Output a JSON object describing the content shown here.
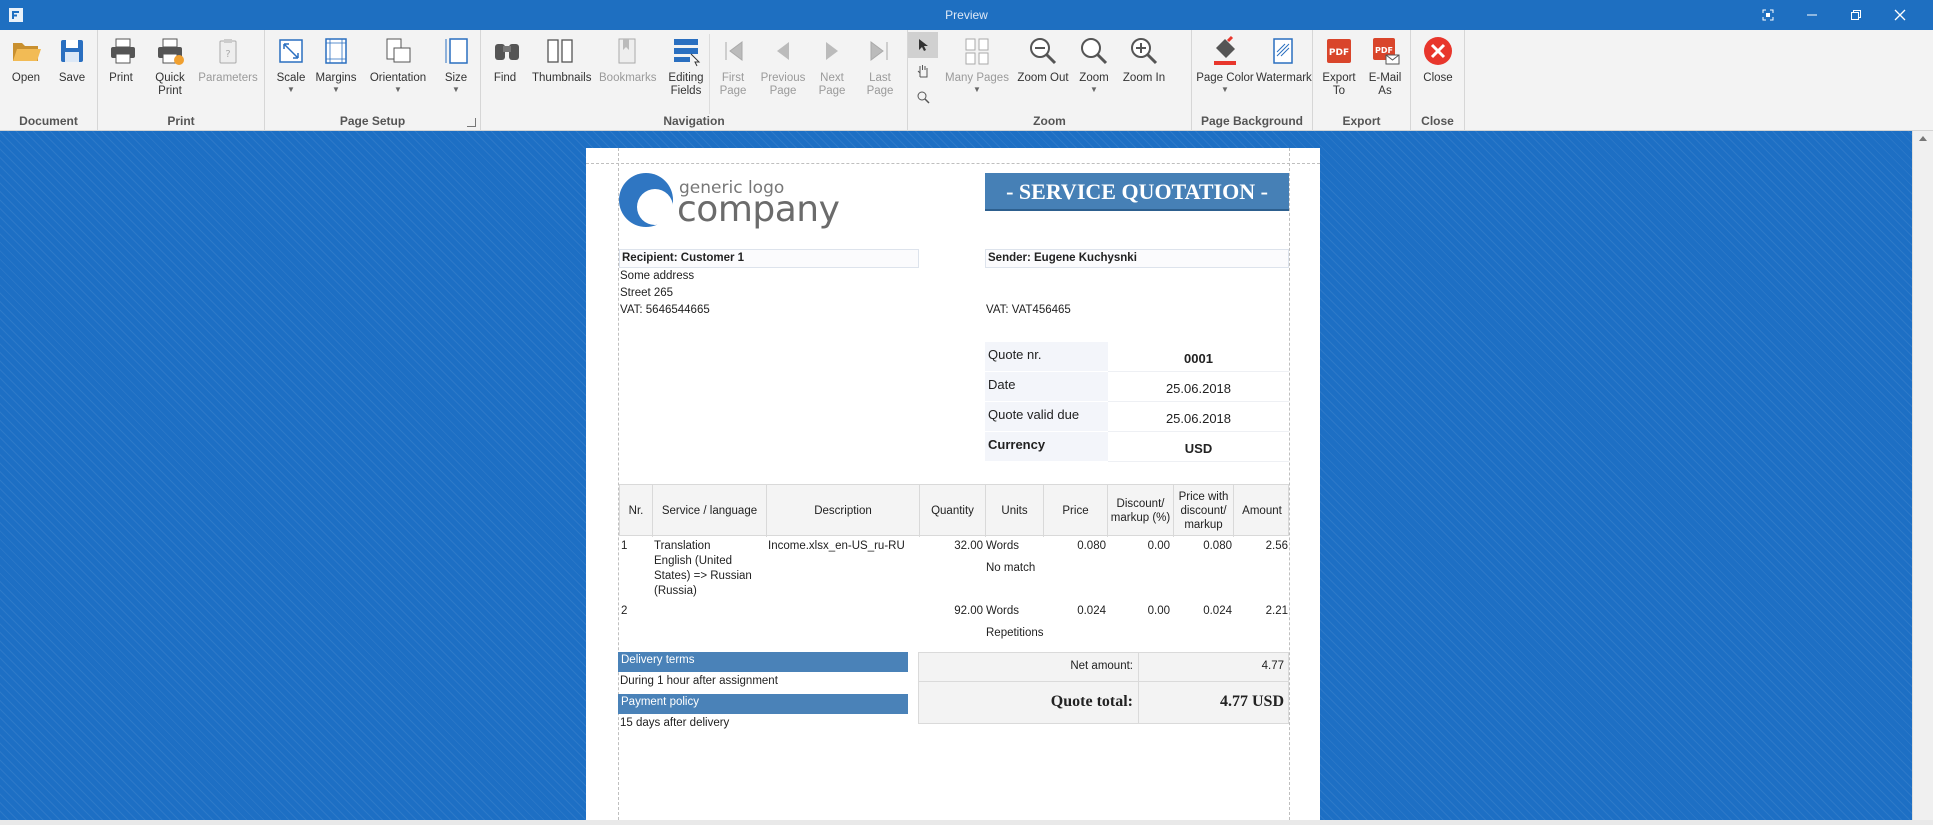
{
  "window": {
    "title": "Preview"
  },
  "ribbon": {
    "groups": {
      "document": "Document",
      "print": "Print",
      "page_setup": "Page Setup",
      "navigation": "Navigation",
      "zoom": "Zoom",
      "page_background": "Page Background",
      "export": "Export",
      "close": "Close"
    },
    "buttons": {
      "open": "Open",
      "save": "Save",
      "print": "Print",
      "quick_print_1": "Quick",
      "quick_print_2": "Print",
      "parameters": "Parameters",
      "scale": "Scale",
      "margins": "Margins",
      "orientation": "Orientation",
      "size": "Size",
      "find": "Find",
      "thumbnails": "Thumbnails",
      "bookmarks": "Bookmarks",
      "editing_fields_1": "Editing",
      "editing_fields_2": "Fields",
      "first_page_1": "First",
      "first_page_2": "Page",
      "previous_page_1": "Previous",
      "previous_page_2": "Page",
      "next_page_1": "Next",
      "next_page_2": "Page",
      "last_page_1": "Last",
      "last_page_2": "Page",
      "many_pages": "Many Pages",
      "zoom_out": "Zoom Out",
      "zoom": "Zoom",
      "zoom_in": "Zoom In",
      "page_color": "Page Color",
      "watermark": "Watermark",
      "export_to_1": "Export",
      "export_to_2": "To",
      "email_as_1": "E-Mail",
      "email_as_2": "As",
      "close": "Close"
    }
  },
  "document": {
    "logo_small": "generic logo",
    "logo_big": "company",
    "title": "- SERVICE QUOTATION -",
    "recipient": {
      "heading": "Recipient: Customer 1",
      "address1": "Some address",
      "address2": "Street 265",
      "vat": "VAT: 5646544665"
    },
    "sender": {
      "heading": "Sender: Eugene Kuchysnki",
      "vat": "VAT: VAT456465"
    },
    "meta": {
      "quote_nr_label": "Quote nr.",
      "quote_nr": "0001",
      "date_label": "Date",
      "date": "25.06.2018",
      "valid_label": "Quote valid due",
      "valid": "25.06.2018",
      "currency_label": "Currency",
      "currency": "USD"
    },
    "table": {
      "headers": {
        "nr": "Nr.",
        "service": "Service / language",
        "description": "Description",
        "quantity": "Quantity",
        "units": "Units",
        "price": "Price",
        "discount_1": "Discount/",
        "discount_2": "markup (%)",
        "pwd_1": "Price with",
        "pwd_2": "discount/",
        "pwd_3": "markup",
        "amount": "Amount"
      },
      "rows": [
        {
          "nr": "1",
          "service_1": "Translation",
          "service_2": "English (United",
          "service_3": "States) => Russian",
          "service_4": "(Russia)",
          "description": "Income.xlsx_en-US_ru-RU",
          "quantity": "32.00",
          "units_1": "Words",
          "units_2": "No match",
          "price": "0.080",
          "discount": "0.00",
          "pwd": "0.080",
          "amount": "2.56"
        },
        {
          "nr": "2",
          "quantity": "92.00",
          "units_1": "Words",
          "units_2": "Repetitions",
          "price": "0.024",
          "discount": "0.00",
          "pwd": "0.024",
          "amount": "2.21"
        }
      ]
    },
    "delivery_terms_label": "Delivery terms",
    "delivery_terms": "During 1 hour after assignment",
    "payment_policy_label": "Payment policy",
    "payment_policy": "15 days after delivery",
    "net_amount_label": "Net amount:",
    "net_amount": "4.77",
    "quote_total_label": "Quote total:",
    "quote_total": "4.77 USD"
  },
  "colors": {
    "titlebar": "#1e6fc1",
    "preview_background": "#1d6fc4",
    "banner": "#4680b6",
    "section_bar": "#4a82b8",
    "close_icon": "#e8362c",
    "pdf_icon": "#d9452b"
  }
}
